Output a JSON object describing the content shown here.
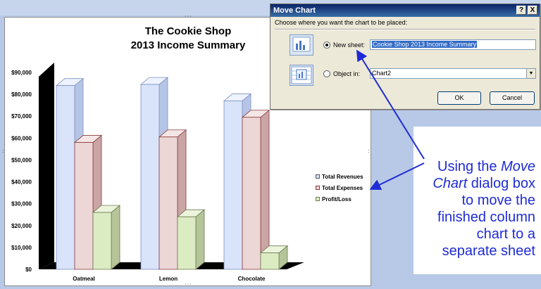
{
  "dialog": {
    "title": "Move Chart",
    "help_btn": "?",
    "close_btn": "X",
    "instruction": "Choose where you want the chart to be placed:",
    "new_sheet_label": "New sheet:",
    "new_sheet_value": "Cookie Shop 2013 Income Summary",
    "object_in_label": "Object in:",
    "object_in_value": "Chart2",
    "selected_option": "New sheet",
    "ok_label": "OK",
    "cancel_label": "Cancel"
  },
  "annotation": {
    "lines": [
      "Using the Move",
      "Chart dialog box",
      "to move the",
      "finished column",
      "chart to a",
      "separate sheet"
    ],
    "color": "#1f2bd4"
  },
  "chart": {
    "title_line1": "The Cookie Shop",
    "title_line2": "2013 Income Summary",
    "legend": [
      "Total Revenues",
      "Total Expenses",
      "Profit/Loss"
    ]
  },
  "chart_data": {
    "type": "bar",
    "title": "The Cookie Shop 2013 Income Summary",
    "categories": [
      "Oatmeal",
      "Lemon",
      "Chocolate"
    ],
    "series": [
      {
        "name": "Total Revenues",
        "values": [
          84000,
          84500,
          77000
        ],
        "color": "#d9e4fb"
      },
      {
        "name": "Total Expenses",
        "values": [
          58000,
          60500,
          69500
        ],
        "color": "#ecd6d6"
      },
      {
        "name": "Profit/Loss",
        "values": [
          26000,
          24000,
          7500
        ],
        "color": "#dcecc2"
      }
    ],
    "y_ticks": [
      "$0",
      "$10,000",
      "$20,000",
      "$30,000",
      "$40,000",
      "$50,000",
      "$60,000",
      "$70,000",
      "$80,000",
      "$90,000"
    ],
    "ylim": [
      0,
      90000
    ],
    "legend_position": "right",
    "style": "3d-column"
  }
}
